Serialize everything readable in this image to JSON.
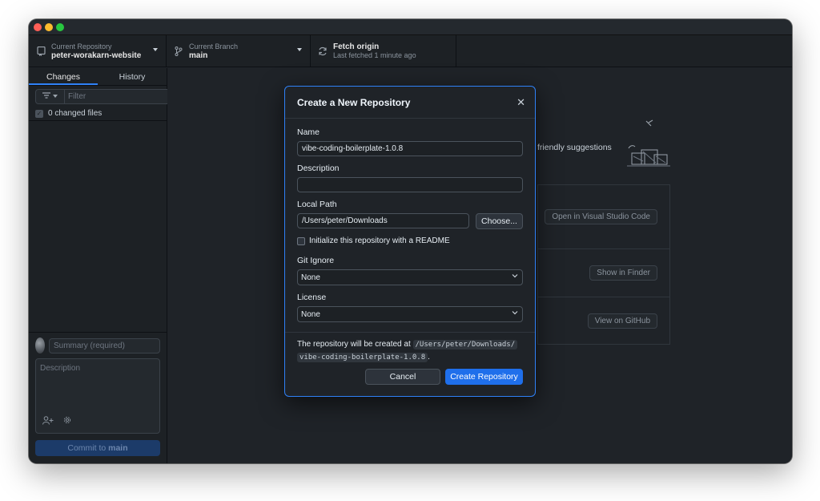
{
  "toolbar": {
    "repo_label": "Current Repository",
    "repo_value": "peter-worakarn-website",
    "branch_label": "Current Branch",
    "branch_value": "main",
    "fetch_label": "Fetch origin",
    "fetch_sub": "Last fetched 1 minute ago"
  },
  "sidebar": {
    "tabs": [
      "Changes",
      "History"
    ],
    "filter_placeholder": "Filter",
    "changed_files": "0 changed files",
    "summary_placeholder": "Summary (required)",
    "description_placeholder": "Description",
    "commit_prefix": "Commit to",
    "commit_branch": "main"
  },
  "background": {
    "suggestions_text": "friendly suggestions",
    "open_vscode": "Open in Visual Studio Code",
    "show_finder": "Show in Finder",
    "view_github": "View on GitHub"
  },
  "modal": {
    "title": "Create a New Repository",
    "name_label": "Name",
    "name_value": "vibe-coding-boilerplate-1.0.8",
    "description_label": "Description",
    "description_value": "",
    "local_path_label": "Local Path",
    "local_path_value": "/Users/peter/Downloads",
    "choose_label": "Choose...",
    "readme_label": "Initialize this repository with a README",
    "gitignore_label": "Git Ignore",
    "gitignore_value": "None",
    "license_label": "License",
    "license_value": "None",
    "footer_text": "The repository will be created at",
    "footer_path_1": "/Users/peter/Downloads/",
    "footer_path_2": "vibe-coding-boilerplate-1.0.8",
    "footer_period": ".",
    "cancel_label": "Cancel",
    "create_label": "Create Repository"
  },
  "colors": {
    "accent": "#2f81f7",
    "primary_button": "#1f6feb",
    "window_bg": "#1f2328"
  }
}
